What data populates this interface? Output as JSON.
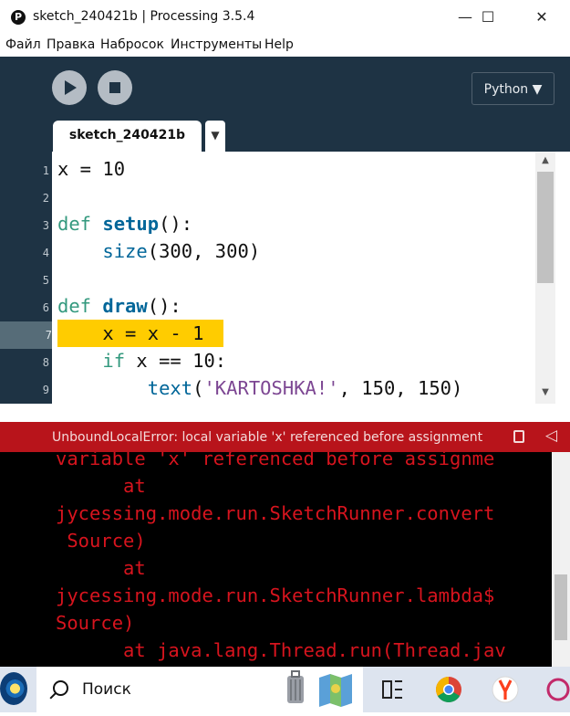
{
  "window": {
    "title": "sketch_240421b | Processing 3.5.4",
    "app_icon_glyph": "P",
    "minimize_glyph": "—",
    "maximize_glyph": "☐",
    "close_glyph": "✕"
  },
  "menu": {
    "items": [
      "Файл",
      "Правка",
      "Набросок",
      "Инструменты",
      "Help"
    ]
  },
  "toolbar": {
    "mode_label": "Python ▼"
  },
  "tabs": {
    "active_label": "sketch_240421b",
    "menu_glyph": "▼"
  },
  "editor": {
    "line_numbers": [
      "1",
      "2",
      "3",
      "4",
      "5",
      "6",
      "7",
      "8",
      "9"
    ],
    "highlighted_line": 7,
    "code": {
      "l1": "x = 10",
      "l3_kw": "def",
      "l3_fn": "setup",
      "l3_rest": "():",
      "l4_call": "size",
      "l4_rest": "(300, 300)",
      "l6_kw": "def",
      "l6_fn": "draw",
      "l6_rest": "():",
      "l7": "x = x - 1",
      "l8_kw": "if",
      "l8_rest": " x == 10:",
      "l9_call": "text",
      "l9_open": "(",
      "l9_str": "'KARTOSHKA!'",
      "l9_rest": ", 150, 150)"
    }
  },
  "error_bar": {
    "message": "UnboundLocalError: local variable 'x' referenced before assignment"
  },
  "console": {
    "lines": [
      "variable 'x' referenced before assignme",
      "      at",
      "jycessing.mode.run.SketchRunner.convert",
      " Source)",
      "      at",
      "jycessing.mode.run.SketchRunner.lambda$",
      "Source)",
      "      at java.lang.Thread.run(Thread.jav"
    ]
  },
  "taskbar": {
    "search_placeholder": "Поиск"
  },
  "colors": {
    "toolbar_bg": "#1e3344",
    "highlight": "#ffcc00",
    "error_bar": "#b8141b",
    "console_text": "#d7141e"
  }
}
